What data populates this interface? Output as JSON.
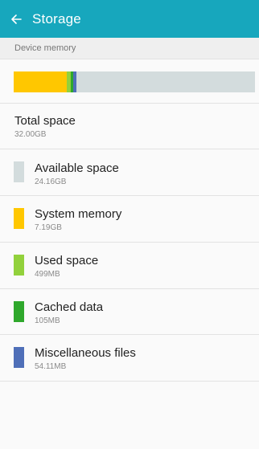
{
  "appbar": {
    "title": "Storage",
    "back_icon": "arrow-left-icon"
  },
  "section": {
    "label": "Device memory"
  },
  "usage_bar": {
    "segments": [
      {
        "name": "System memory",
        "color": "#ffc700",
        "value_gb": 7.19
      },
      {
        "name": "Used space",
        "color": "#92d13c",
        "value_gb": 0.499
      },
      {
        "name": "Cached data",
        "color": "#2fa82c",
        "value_gb": 0.105
      },
      {
        "name": "Miscellaneous files",
        "color": "#4f6fb8",
        "value_gb": 0.054
      },
      {
        "name": "Available space",
        "color": "#d3dcdd",
        "value_gb": 24.16
      }
    ],
    "total_gb": 32.0
  },
  "total": {
    "label": "Total space",
    "value": "32.00GB"
  },
  "items": [
    {
      "label": "Available space",
      "value": "24.16GB",
      "color": "#d3dcdd"
    },
    {
      "label": "System memory",
      "value": "7.19GB",
      "color": "#ffc700"
    },
    {
      "label": "Used space",
      "value": "499MB",
      "color": "#92d13c"
    },
    {
      "label": "Cached data",
      "value": "105MB",
      "color": "#2fa82c"
    },
    {
      "label": "Miscellaneous files",
      "value": "54.11MB",
      "color": "#4f6fb8"
    }
  ]
}
